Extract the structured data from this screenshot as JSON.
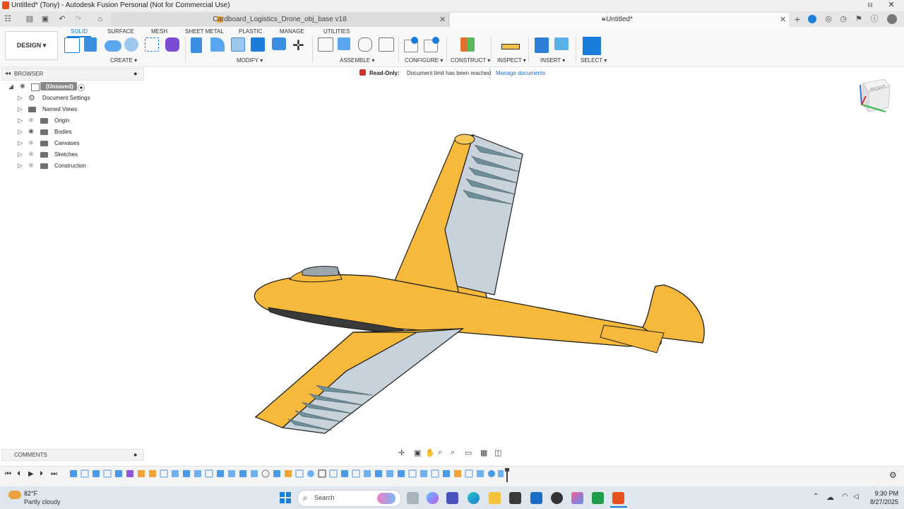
{
  "window": {
    "title": "Untitled* (Tony) - Autodesk Fusion Personal (Not for Commercial Use)",
    "controls": [
      "–",
      "□",
      "✕"
    ]
  },
  "tabs": [
    {
      "label": "Cardboard_Logistics_Drone_obj_base v18",
      "active": false
    },
    {
      "label": "Untitled*",
      "active": true
    }
  ],
  "toolbar": {
    "workspace_button": "DESIGN ▾",
    "workspace_tabs": [
      "SOLID",
      "SURFACE",
      "MESH",
      "SHEET METAL",
      "PLASTIC",
      "MANAGE",
      "UTILITIES"
    ],
    "groups": {
      "create": "CREATE ▾",
      "modify": "MODIFY ▾",
      "assemble": "ASSEMBLE ▾",
      "configure": "CONFIGURE ▾",
      "construct": "CONSTRUCT ▾",
      "inspect": "INSPECT ▾",
      "insert": "INSERT ▾",
      "select": "SELECT ▾"
    }
  },
  "browser": {
    "header": "BROWSER",
    "root": "(Unsaved)",
    "items": [
      {
        "label": "Document Settings"
      },
      {
        "label": "Named Views"
      },
      {
        "label": "Origin"
      },
      {
        "label": "Bodies"
      },
      {
        "label": "Canvases"
      },
      {
        "label": "Sketches"
      },
      {
        "label": "Construction"
      }
    ]
  },
  "readonly": {
    "label": "Read-Only:",
    "message": "Document limit has been reached",
    "link": "Manage documents"
  },
  "viewcube": {
    "face": "RIGHT"
  },
  "comments": {
    "label": "COMMENTS"
  },
  "taskbar": {
    "weather_temp": "82°F",
    "weather_desc": "Partly cloudy",
    "search_placeholder": "Search",
    "time": "9:30 PM",
    "date": "8/27/2025"
  },
  "colors": {
    "accent": "#1a7dd9",
    "model_body": "#f6b93b",
    "model_panel": "#c7d2da",
    "fusion_orange": "#e8501c"
  }
}
